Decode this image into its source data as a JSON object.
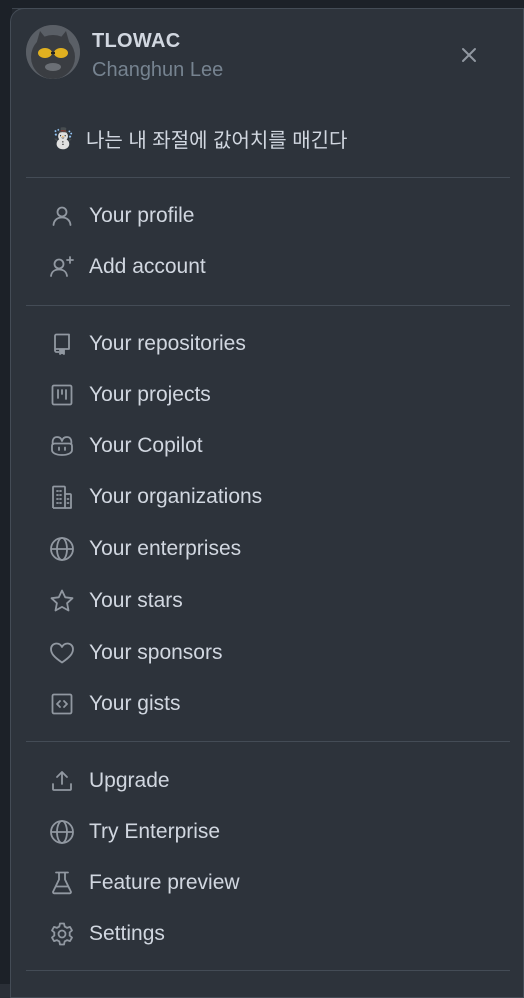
{
  "user": {
    "username": "TLOWAC",
    "full_name": "Changhun Lee",
    "status_emoji": "☃️",
    "status_text": "나는 내 좌절에 값어치를 매긴다"
  },
  "menu": {
    "account": [
      {
        "label": "Your profile",
        "icon": "person-icon"
      },
      {
        "label": "Add account",
        "icon": "person-add-icon"
      }
    ],
    "main": [
      {
        "label": "Your repositories",
        "icon": "repo-icon"
      },
      {
        "label": "Your projects",
        "icon": "project-icon"
      },
      {
        "label": "Your Copilot",
        "icon": "copilot-icon"
      },
      {
        "label": "Your organizations",
        "icon": "organization-icon"
      },
      {
        "label": "Your enterprises",
        "icon": "globe-icon"
      },
      {
        "label": "Your stars",
        "icon": "star-icon"
      },
      {
        "label": "Your sponsors",
        "icon": "heart-icon"
      },
      {
        "label": "Your gists",
        "icon": "code-square-icon"
      }
    ],
    "bottom": [
      {
        "label": "Upgrade",
        "icon": "upload-icon"
      },
      {
        "label": "Try Enterprise",
        "icon": "globe-icon"
      },
      {
        "label": "Feature preview",
        "icon": "beaker-icon"
      },
      {
        "label": "Settings",
        "icon": "gear-icon"
      }
    ]
  },
  "colors": {
    "panel_bg": "#2d333b",
    "text": "#d1d7e0",
    "muted": "#768390",
    "icon": "#9198a1",
    "border": "#444c56"
  }
}
